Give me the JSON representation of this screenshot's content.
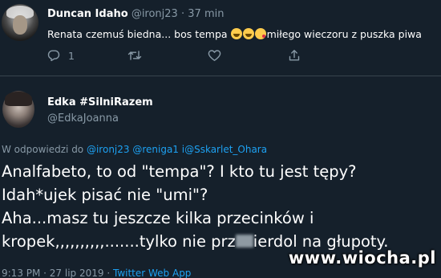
{
  "tweet1": {
    "name": "Duncan Idaho",
    "handle": "@ironj23",
    "separator": "·",
    "time": "37 min",
    "text_before": "Renata czemuś biedna... bos tempa ",
    "text_after": "miłego wieczoru z puszka piwa",
    "emojis": [
      "grinning-face",
      "grinning-face",
      "face-blowing-kiss"
    ],
    "reply_count": "1"
  },
  "tweet2": {
    "name": "Edka #SilniRazem",
    "handle": "@EdkaJoanna",
    "reply_context": {
      "prefix": "W odpowiedzi do ",
      "mentions": "@ironj23 @reniga1 i@Sskarlet_Ohara"
    },
    "body": [
      "Analfabeto, to od \"tempa\"? I kto tu jest tępy?",
      "Idah*ujek pisać nie \"umi\"?",
      "Aha...masz tu jeszcze kilka przecinków i"
    ],
    "last_line_before": "kropek,,,,,,,,,,.......tylko nie prz",
    "last_line_after": "ierdol na głupoty.",
    "footer_time": "9:13 PM · 27 lip 2019 · ",
    "footer_source": "Twitter Web App"
  },
  "watermark": "www.wiocha.pl",
  "colors": {
    "background": "#15202b",
    "text": "#ffffff",
    "secondary": "#8899a6",
    "link": "#1da1f2"
  }
}
